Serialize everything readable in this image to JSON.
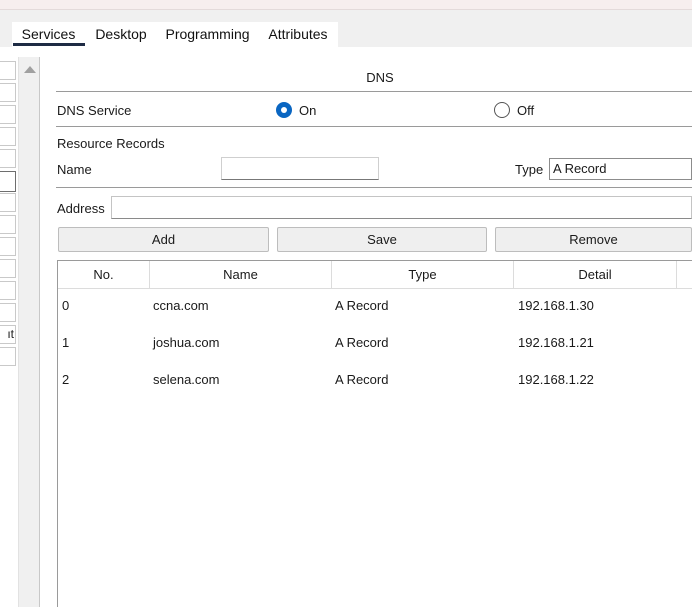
{
  "tabs": [
    {
      "label": "Services",
      "selected": true
    },
    {
      "label": "Desktop",
      "selected": false
    },
    {
      "label": "Programming",
      "selected": false
    },
    {
      "label": "Attributes",
      "selected": false
    }
  ],
  "left_sidebar": {
    "partial_item_text": "ıt"
  },
  "dns": {
    "title": "DNS",
    "service_label": "DNS Service",
    "on_label": "On",
    "off_label": "Off",
    "selected": "On",
    "resource_records_label": "Resource Records",
    "name_label": "Name",
    "name_value": "",
    "type_label": "Type",
    "type_value": "A Record",
    "address_label": "Address",
    "address_value": "",
    "buttons": {
      "add": "Add",
      "save": "Save",
      "remove": "Remove"
    }
  },
  "table": {
    "columns": [
      "No.",
      "Name",
      "Type",
      "Detail"
    ],
    "rows": [
      {
        "no": "0",
        "name": "ccna.com",
        "type": "A Record",
        "detail": "192.168.1.30"
      },
      {
        "no": "1",
        "name": "joshua.com",
        "type": "A Record",
        "detail": "192.168.1.21"
      },
      {
        "no": "2",
        "name": "selena.com",
        "type": "A Record",
        "detail": "192.168.1.22"
      }
    ]
  },
  "colors": {
    "accent": "#0a66c2",
    "tab_underline": "#1e2b44",
    "tab_bar": "#f0f0f0"
  }
}
